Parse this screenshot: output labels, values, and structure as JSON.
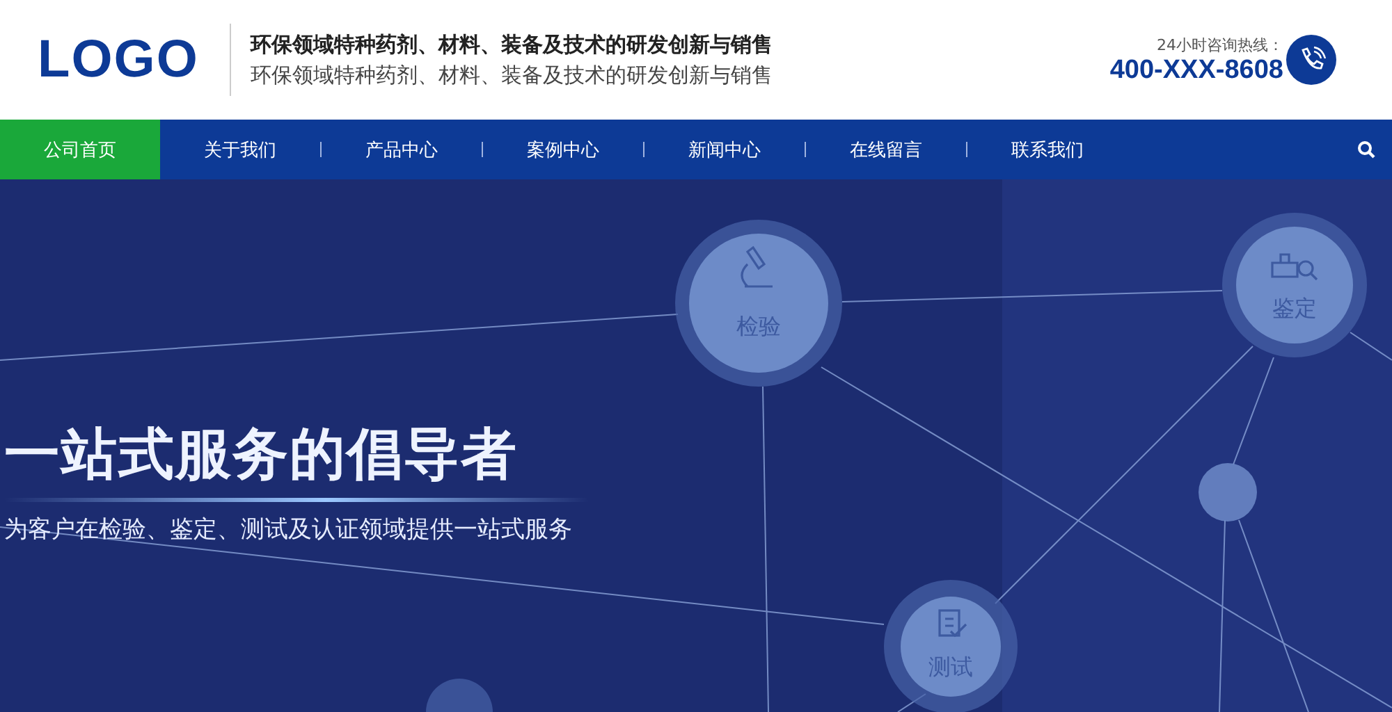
{
  "header": {
    "logo": "LOGO",
    "title": "环保领域特种药剂、材料、装备及技术的研发创新与销售",
    "subtitle": "环保领域特种药剂、材料、装备及技术的研发创新与销售",
    "hotline_label": "24小时咨询热线：",
    "hotline": "400-XXX-8608"
  },
  "nav": {
    "items": [
      {
        "label": "公司首页",
        "selected": true
      },
      {
        "label": "关于我们",
        "selected": false
      },
      {
        "label": "产品中心",
        "selected": false
      },
      {
        "label": "案例中心",
        "selected": false
      },
      {
        "label": "新闻中心",
        "selected": false
      },
      {
        "label": "在线留言",
        "selected": false
      },
      {
        "label": "联系我们",
        "selected": false
      }
    ]
  },
  "hero": {
    "title": "一站式服务的倡导者",
    "subtitle": "为客户在检验、鉴定、测试及认证领域提供一站式服务",
    "nodes": [
      {
        "kind": "microscope",
        "label": "检验"
      },
      {
        "kind": "stamp",
        "label": "鉴定"
      },
      {
        "kind": "clipboard",
        "label": "测试"
      }
    ]
  }
}
